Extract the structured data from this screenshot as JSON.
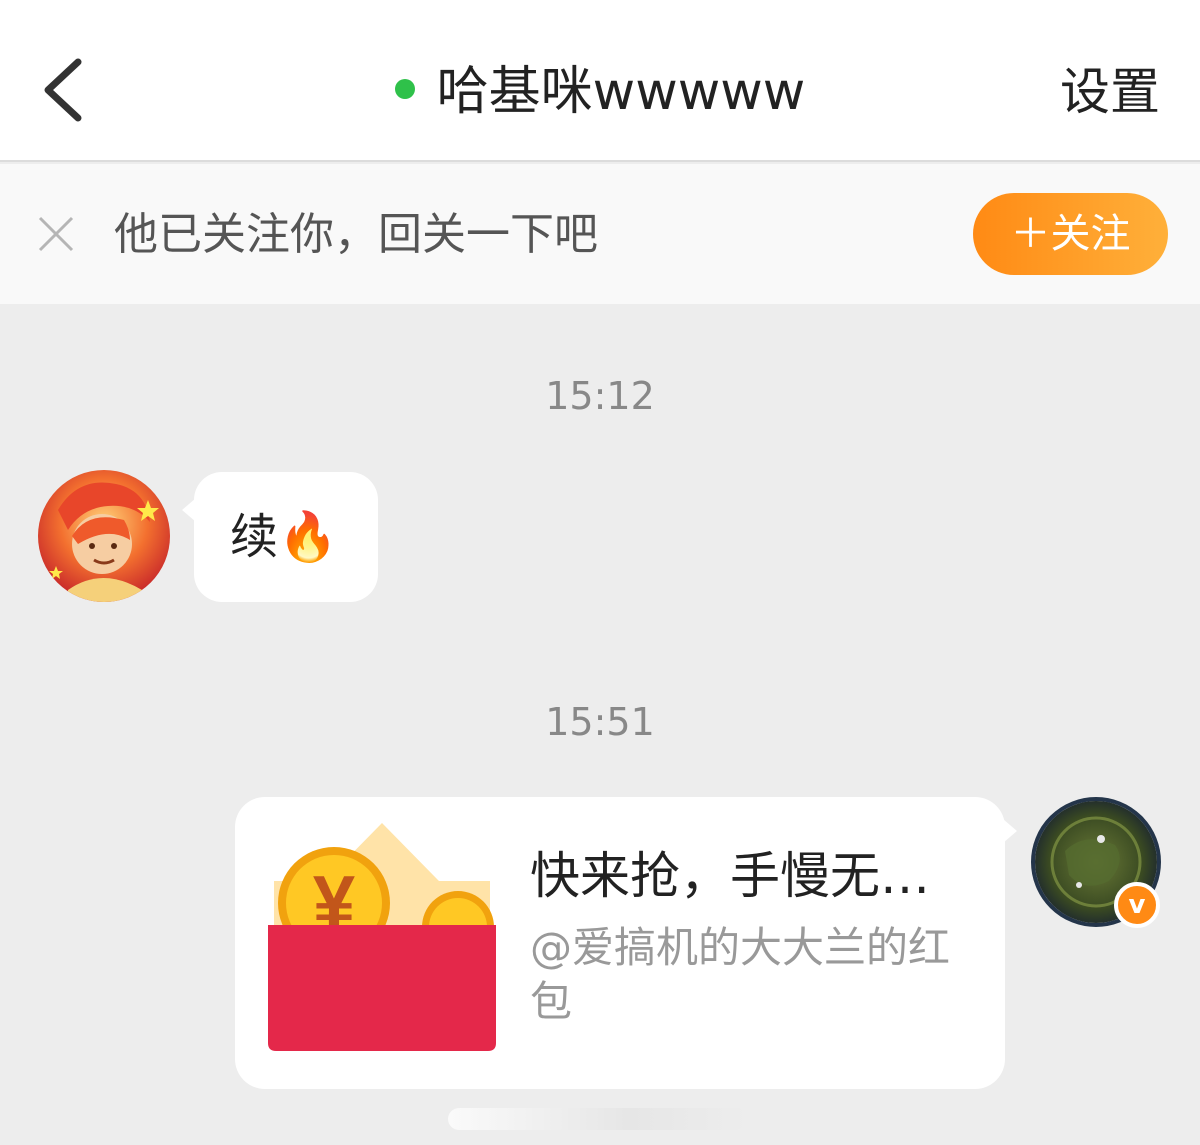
{
  "header": {
    "title": "哈基咪wwwww",
    "settings_label": "设置",
    "online_color": "#2fc14a"
  },
  "notice": {
    "text": "他已关注你，回关一下吧",
    "follow_label": "＋关注",
    "accent": "#ff8a14"
  },
  "messages": [
    {
      "time": "15:12",
      "sender": "other",
      "text": "续🔥"
    },
    {
      "time": "15:51",
      "sender": "me",
      "type": "red-packet",
      "title": "快来抢，手慢无…",
      "subtitle": "@爱搞机的大大兰的红包"
    }
  ],
  "icons": [
    "back-chevron-icon",
    "close-icon",
    "red-packet-icon",
    "verified-v-icon"
  ],
  "verified_badge": "v"
}
